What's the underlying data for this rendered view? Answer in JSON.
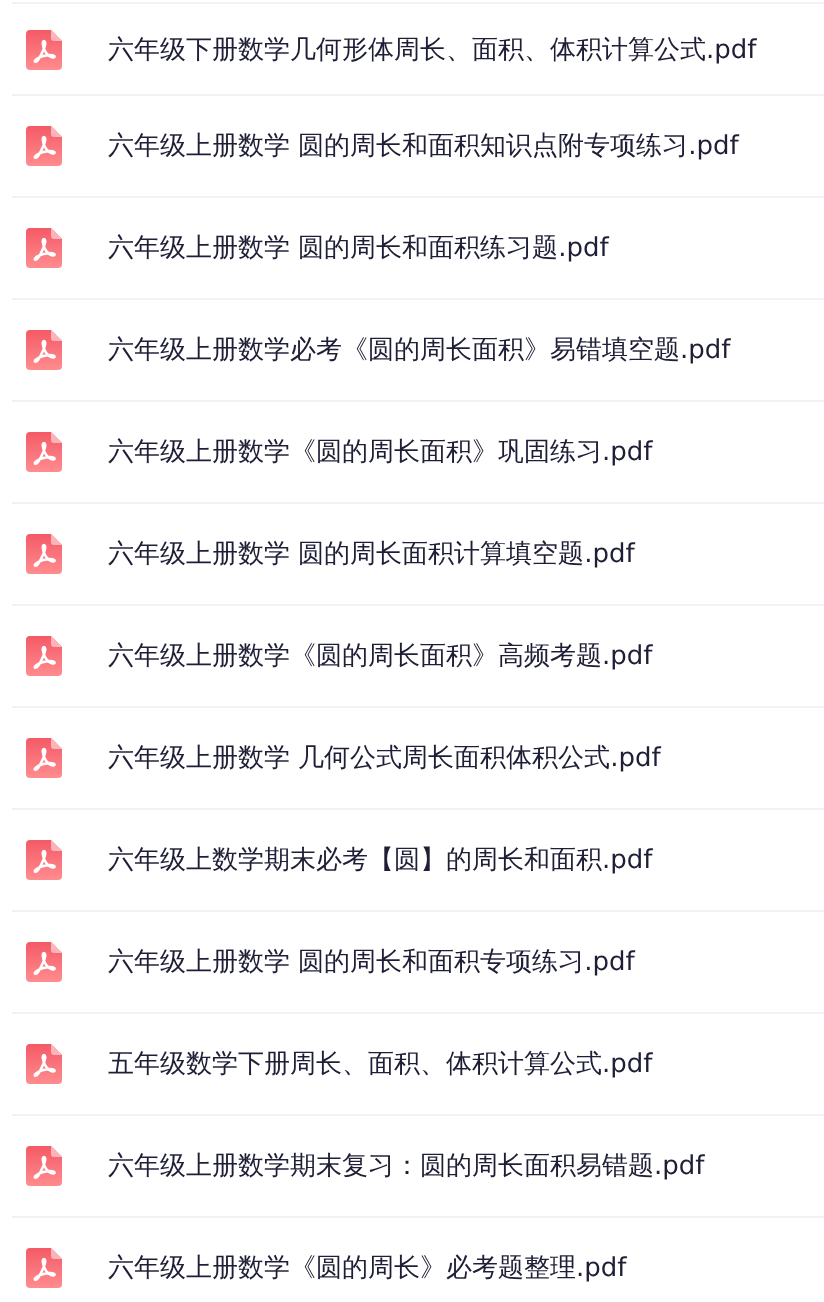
{
  "files": [
    {
      "name": "六年级下册数学几何形体周长、面积、体积计算公式.pdf"
    },
    {
      "name": "六年级上册数学 圆的周长和面积知识点附专项练习.pdf"
    },
    {
      "name": "六年级上册数学 圆的周长和面积练习题.pdf"
    },
    {
      "name": "六年级上册数学必考《圆的周长面积》易错填空题.pdf"
    },
    {
      "name": "六年级上册数学《圆的周长面积》巩固练习.pdf"
    },
    {
      "name": "六年级上册数学 圆的周长面积计算填空题.pdf"
    },
    {
      "name": "六年级上册数学《圆的周长面积》高频考题.pdf"
    },
    {
      "name": "六年级上册数学 几何公式周长面积体积公式.pdf"
    },
    {
      "name": "六年级上数学期末必考【圆】的周长和面积.pdf"
    },
    {
      "name": "六年级上册数学 圆的周长和面积专项练习.pdf"
    },
    {
      "name": "五年级数学下册周长、面积、体积计算公式.pdf"
    },
    {
      "name": "六年级上册数学期末复习：圆的周长面积易错题.pdf"
    },
    {
      "name": "六年级上册数学《圆的周长》必考题整理.pdf"
    }
  ]
}
